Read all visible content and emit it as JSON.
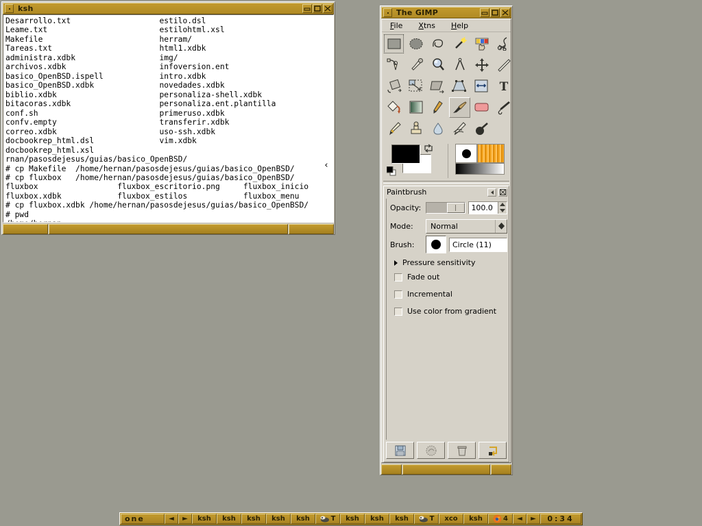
{
  "desktop": {
    "background_color": "#9a9a90"
  },
  "terminal": {
    "title": "ksh",
    "icon": "window-menu-icon",
    "buttons": [
      {
        "name": "minimize-button",
        "glyph": "minimize-icon"
      },
      {
        "name": "maximize-button",
        "glyph": "maximize-icon"
      },
      {
        "name": "close-button",
        "glyph": "close-icon"
      }
    ],
    "scroll_indicator": "‹",
    "content": "Desarrollo.txt                   estilo.dsl\nLeame.txt                        estilohtml.xsl\nMakefile                         herram/\nTareas.txt                       html1.xdbk\nadministra.xdbk                  img/\narchivos.xdbk                    infoversion.ent\nbasico_OpenBSD.ispell            intro.xdbk\nbasico_OpenBSD.xdbk              novedades.xdbk\nbiblio.xdbk                      personaliza-shell.xdbk\nbitacoras.xdbk                   personaliza.ent.plantilla\nconf.sh                          primeruso.xdbk\nconfv.empty                      transferir.xdbk\ncorreo.xdbk                      uso-ssh.xdbk\ndocbookrep_html.dsl              vim.xdbk\ndocbookrep_html.xsl\nrnan/pasosdejesus/guias/basico_OpenBSD/\n# cp Makefile  /home/hernan/pasosdejesus/guias/basico_OpenBSD/\n# cp fluxbox   /home/hernan/pasosdejesus/guias/basico_OpenBSD/\nfluxbox                 fluxbox_escritorio.png     fluxbox_inicio\nfluxbox.xdbk            fluxbox_estilos            fluxbox_menu\n# cp fluxbox.xdbk /home/hernan/pasosdejesus/guias/basico_OpenBSD/\n# pwd\n/home/hernan\n# ⎕"
  },
  "gimp": {
    "title": "The GIMP",
    "icon": "window-menu-icon",
    "buttons": [
      {
        "name": "minimize-button",
        "glyph": "minimize-icon"
      },
      {
        "name": "maximize-button",
        "glyph": "maximize-icon"
      },
      {
        "name": "close-button",
        "glyph": "close-icon"
      }
    ],
    "menu": [
      {
        "label": "File",
        "mnemonic": "F"
      },
      {
        "label": "Xtns",
        "mnemonic": "X"
      },
      {
        "label": "Help",
        "mnemonic": "H"
      }
    ],
    "tools": [
      {
        "name": "rect-select-tool",
        "selected": true
      },
      {
        "name": "ellipse-select-tool",
        "selected": false
      },
      {
        "name": "free-select-tool",
        "selected": false
      },
      {
        "name": "fuzzy-select-tool",
        "selected": false
      },
      {
        "name": "select-by-color-tool",
        "selected": false
      },
      {
        "name": "intelligent-scissors-tool",
        "selected": false
      },
      {
        "name": "paths-tool",
        "selected": false
      },
      {
        "name": "color-picker-tool",
        "selected": false
      },
      {
        "name": "magnify-tool",
        "selected": false
      },
      {
        "name": "measure-tool",
        "selected": false
      },
      {
        "name": "move-tool",
        "selected": false
      },
      {
        "name": "crop-tool",
        "selected": false
      },
      {
        "name": "rotate-tool",
        "selected": false
      },
      {
        "name": "scale-tool",
        "selected": false
      },
      {
        "name": "shear-tool",
        "selected": false
      },
      {
        "name": "perspective-tool",
        "selected": false
      },
      {
        "name": "flip-tool",
        "selected": false
      },
      {
        "name": "text-tool",
        "selected": false
      },
      {
        "name": "bucket-fill-tool",
        "selected": false
      },
      {
        "name": "blend-tool",
        "selected": false
      },
      {
        "name": "pencil-tool",
        "selected": false
      },
      {
        "name": "paintbrush-tool",
        "selected": true
      },
      {
        "name": "eraser-tool",
        "selected": false
      },
      {
        "name": "airbrush-tool",
        "selected": false
      },
      {
        "name": "ink-tool",
        "selected": false
      },
      {
        "name": "clone-tool",
        "selected": false
      },
      {
        "name": "convolve-tool",
        "selected": false
      },
      {
        "name": "smudge-tool",
        "selected": false
      },
      {
        "name": "dodge-burn-tool",
        "selected": false
      }
    ],
    "swatches": {
      "foreground_color": "#000000",
      "background_color": "#ffffff",
      "active_brush": "circle-brush",
      "active_pattern": "orange-stripes-pattern",
      "active_gradient": "fg-to-bg-gradient"
    },
    "tool_options": {
      "title": "Paintbrush",
      "opacity": {
        "label": "Opacity:",
        "value": "100.0",
        "slider_percent": 100
      },
      "mode": {
        "label": "Mode:",
        "value": "Normal"
      },
      "brush": {
        "label": "Brush:",
        "value": "Circle (11)"
      },
      "pressure_sensitivity_label": "Pressure sensitivity",
      "checkboxes": [
        {
          "label": "Fade out",
          "checked": false
        },
        {
          "label": "Incremental",
          "checked": false
        },
        {
          "label": "Use color from gradient",
          "checked": false
        }
      ],
      "footer_buttons": [
        {
          "name": "save-options-button",
          "glyph": "floppy-icon"
        },
        {
          "name": "restore-options-button",
          "glyph": "revert-icon"
        },
        {
          "name": "delete-options-button",
          "glyph": "trash-icon"
        },
        {
          "name": "reset-options-button",
          "glyph": "reset-icon"
        }
      ]
    }
  },
  "taskbar": {
    "workspace_label": "one",
    "prev_workspace": "◄",
    "next_workspace": "►",
    "tasks": [
      {
        "label": "ksh",
        "icon": null
      },
      {
        "label": "ksh",
        "icon": null
      },
      {
        "label": "ksh",
        "icon": null
      },
      {
        "label": "ksh",
        "icon": null
      },
      {
        "label": "ksh",
        "icon": null
      },
      {
        "label": "T",
        "icon": "gimp-wilber-icon"
      },
      {
        "label": "ksh",
        "icon": null
      },
      {
        "label": "ksh",
        "icon": null
      },
      {
        "label": "ksh",
        "icon": null
      },
      {
        "label": "T",
        "icon": "gimp-wilber-icon"
      },
      {
        "label": "xco",
        "icon": null
      },
      {
        "label": "ksh",
        "icon": null
      },
      {
        "label": "4",
        "icon": "firefox-icon"
      }
    ],
    "prev_task": "◄",
    "next_task": "►",
    "clock": "0:34"
  }
}
